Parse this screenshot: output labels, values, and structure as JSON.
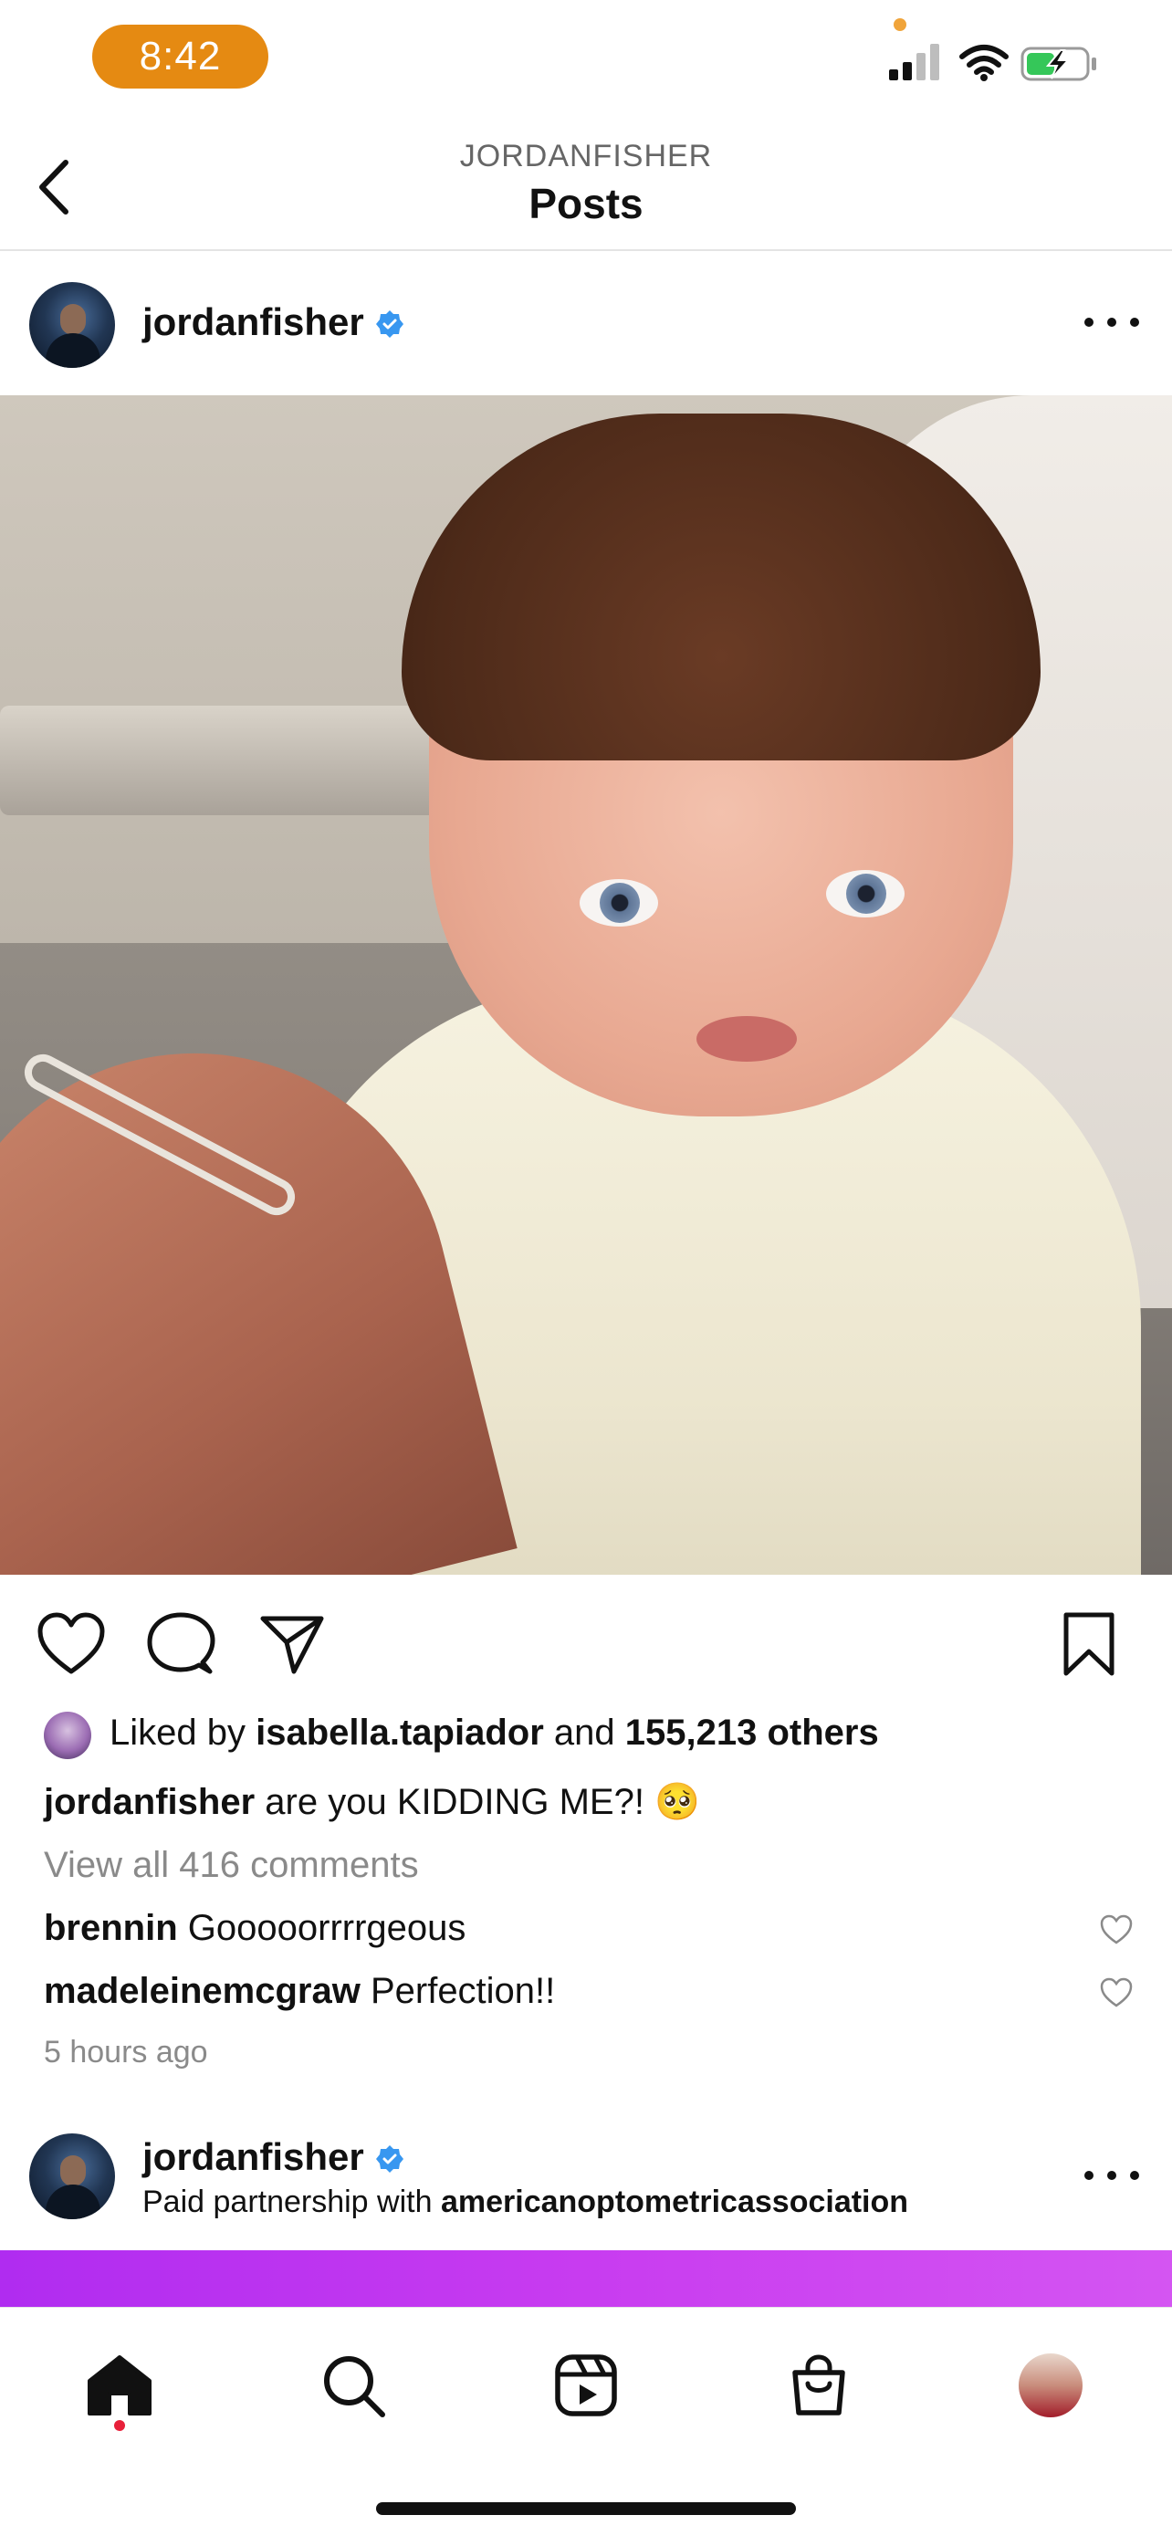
{
  "status_bar": {
    "time": "8:42"
  },
  "nav": {
    "subtitle": "JORDANFISHER",
    "title": "Posts"
  },
  "post": {
    "username": "jordanfisher",
    "verified": true,
    "liked_by_prefix": "Liked by",
    "liked_by_user": "isabella.tapiador",
    "liked_by_and": "and",
    "liked_by_others": "155,213 others",
    "caption_user": "jordanfisher",
    "caption_text": "are you KIDDING ME?!",
    "caption_emoji": "🥺",
    "view_comments": "View all 416 comments",
    "comments": [
      {
        "user": "brennin",
        "text": "Gooooorrrrgeous"
      },
      {
        "user": "madeleinemcgraw",
        "text": "Perfection!!"
      }
    ],
    "timestamp": "5 hours ago"
  },
  "post2": {
    "username": "jordanfisher",
    "verified": true,
    "partnership_prefix": "Paid partnership with",
    "partner": "americanoptometricassociation"
  },
  "icons": {
    "back": "chevron-left-icon",
    "more": "more-horizontal-icon",
    "like": "heart-icon",
    "comment": "comment-icon",
    "share": "paper-plane-icon",
    "save": "bookmark-icon",
    "home": "home-icon",
    "search": "search-icon",
    "reels": "reels-icon",
    "shop": "shopping-bag-icon",
    "profile": "profile-avatar"
  },
  "colors": {
    "verified_blue": "#3897f0",
    "notification_dot": "#e8203a",
    "time_pill": "#e58a12"
  }
}
